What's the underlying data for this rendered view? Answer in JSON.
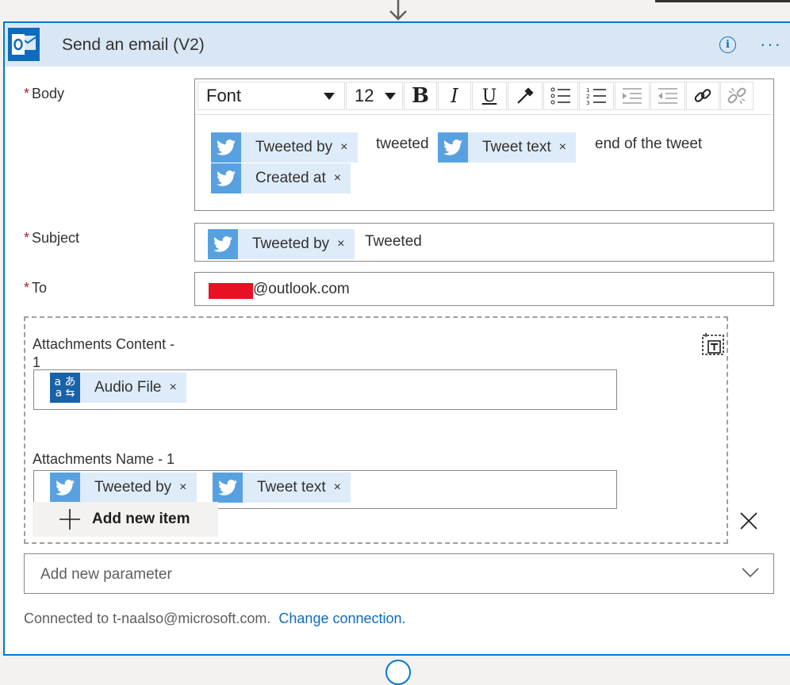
{
  "action": {
    "title": "Send an email (V2)",
    "icons": [
      "outlook-icon",
      "info-icon",
      "more-options-icon"
    ]
  },
  "body_field": {
    "label": "Body",
    "required_marker": "*",
    "toolbar": {
      "font": "Font",
      "size": "12",
      "buttons": [
        "bold",
        "italic",
        "underline",
        "text-color",
        "bulleted-list",
        "numbered-list",
        "decrease-indent",
        "increase-indent",
        "link",
        "unlink"
      ],
      "bold_glyph": "B",
      "italic_glyph": "I",
      "underline_glyph": "U"
    },
    "content": {
      "token1": "Tweeted by",
      "text1": "tweeted",
      "token2": "Tweet text",
      "text2": "end of the tweet",
      "token3": "Created at"
    }
  },
  "subject_field": {
    "label": "Subject",
    "required_marker": "*",
    "token": "Tweeted by",
    "text": "Tweeted"
  },
  "to_field": {
    "label": "To",
    "required_marker": "*",
    "value": "@outlook.com"
  },
  "attachments": {
    "content_label_line1": "Attachments Content -",
    "content_label_line2": "1",
    "content_token": "Audio File",
    "name_label": "Attachments Name - 1",
    "name_token1": "Tweeted by",
    "name_token2": "Tweet text",
    "add_item_label": "Add new item",
    "remove_x": "×",
    "token_x": "×"
  },
  "parameter_dropdown": {
    "placeholder": "Add new parameter"
  },
  "footer": {
    "connected_text": "Connected to t-naalso@microsoft.com.",
    "change_link": "Change connection."
  },
  "colors": {
    "accent": "#0078d4",
    "header_bg": "#d9e7f5",
    "token_bg": "#deecf9",
    "twitter_icon_bg": "#58a1e0",
    "required": "#a4262c",
    "redaction": "#e81123"
  }
}
